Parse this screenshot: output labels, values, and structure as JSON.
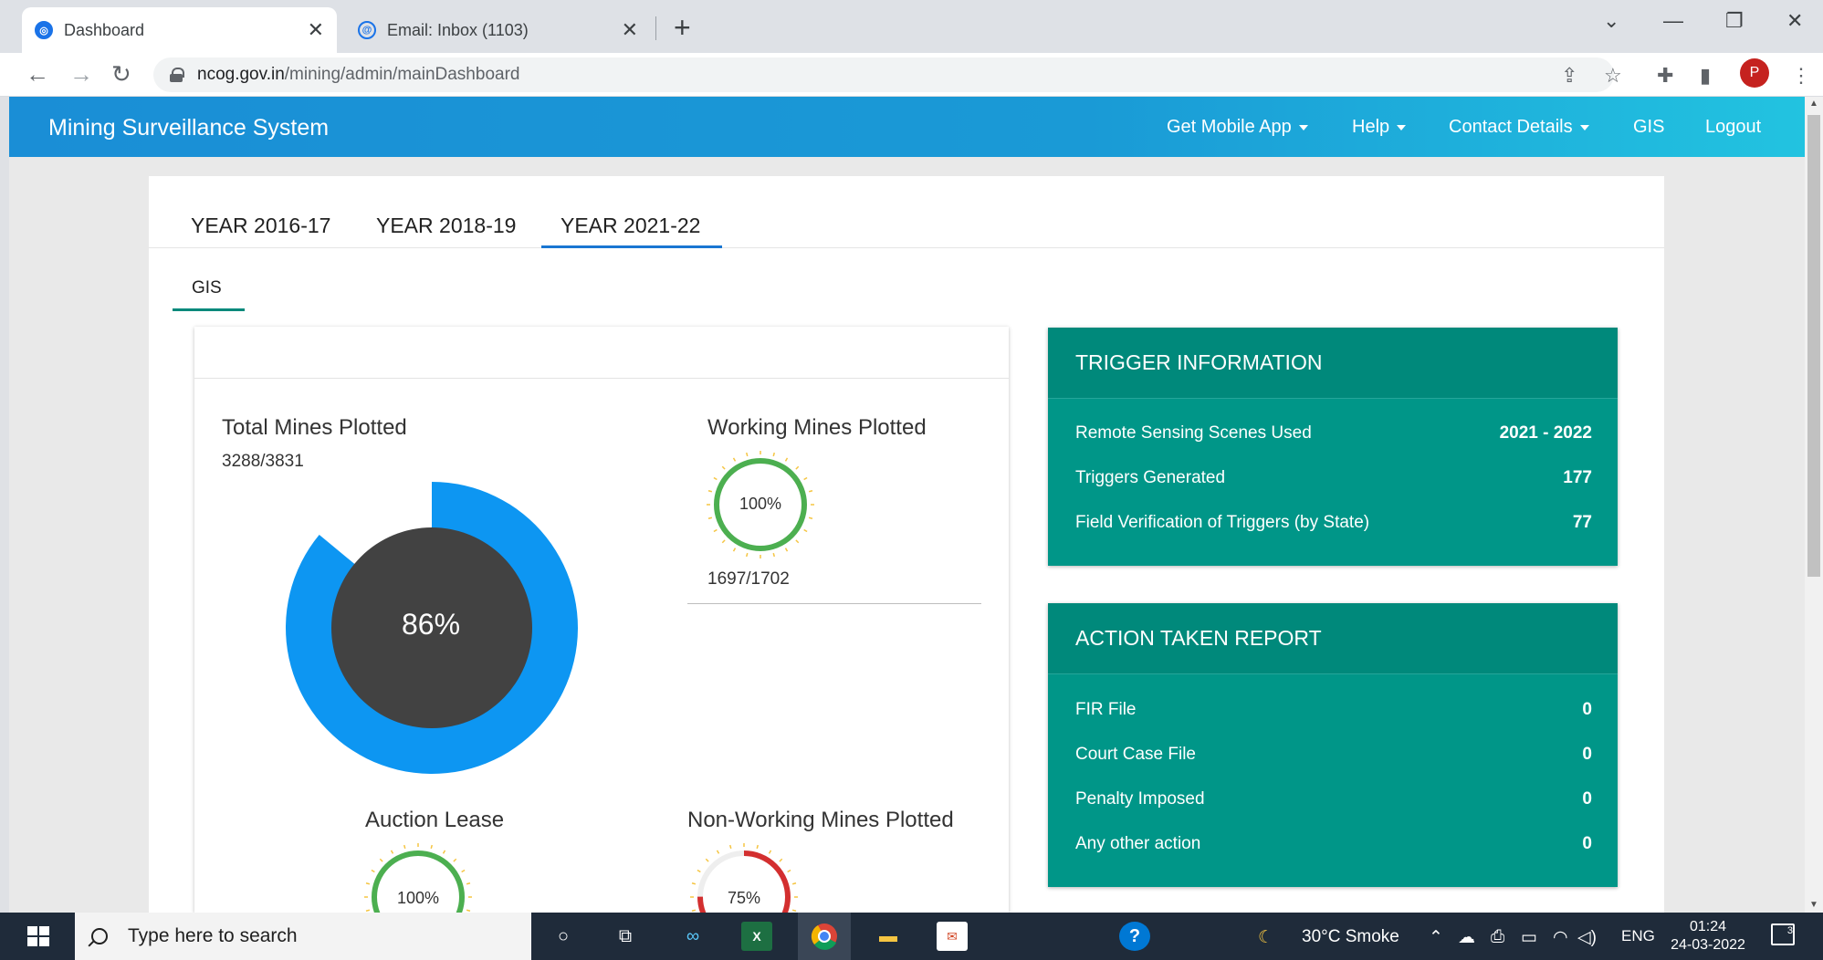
{
  "browser": {
    "tabs": [
      {
        "title": "Dashboard",
        "active": true
      },
      {
        "title": "Email: Inbox (1103)",
        "active": false
      }
    ],
    "url_domain": "ncog.gov.in",
    "url_path": "/mining/admin/mainDashboard",
    "profile_initial": "P"
  },
  "app": {
    "brand": "Mining Surveillance System",
    "nav": {
      "mobile": "Get Mobile App",
      "help": "Help",
      "contact": "Contact Details",
      "gis": "GIS",
      "logout": "Logout"
    }
  },
  "year_tabs": [
    "YEAR 2016-17",
    "YEAR 2018-19",
    "YEAR 2021-22"
  ],
  "active_year_tab": "YEAR 2021-22",
  "sub_tab": "GIS",
  "stats": {
    "total": {
      "title": "Total Mines Plotted",
      "count": "3288/3831",
      "percent_label": "86%",
      "percent": 86
    },
    "working": {
      "title": "Working Mines Plotted",
      "percent_label": "100%",
      "percent": 100,
      "count": "1697/1702"
    },
    "auction": {
      "title": "Auction Lease",
      "percent_label": "100%",
      "percent": 100
    },
    "nonworking": {
      "title": "Non-Working Mines Plotted",
      "percent_label": "75%",
      "percent": 75
    }
  },
  "trigger_info": {
    "title": "TRIGGER INFORMATION",
    "rows": [
      {
        "label": "Remote Sensing Scenes Used",
        "value": "2021 - 2022"
      },
      {
        "label": "Triggers Generated",
        "value": "177"
      },
      {
        "label": "Field Verification of Triggers (by State)",
        "value": "77"
      }
    ]
  },
  "action_report": {
    "title": "ACTION TAKEN REPORT",
    "rows": [
      {
        "label": "FIR File",
        "value": "0"
      },
      {
        "label": "Court Case File",
        "value": "0"
      },
      {
        "label": "Penalty Imposed",
        "value": "0"
      },
      {
        "label": "Any other action",
        "value": "0"
      }
    ]
  },
  "colors": {
    "header_blue": "#1a8ed6",
    "donut_blue": "#0d96f2",
    "donut_dark": "#424242",
    "gauge_green": "#4caf50",
    "gauge_red": "#d32f2f",
    "teal": "#009688"
  },
  "taskbar": {
    "search_placeholder": "Type here to search",
    "weather": "30°C  Smoke",
    "language": "ENG",
    "time": "01:24",
    "date": "24-03-2022",
    "notifications": "3"
  }
}
